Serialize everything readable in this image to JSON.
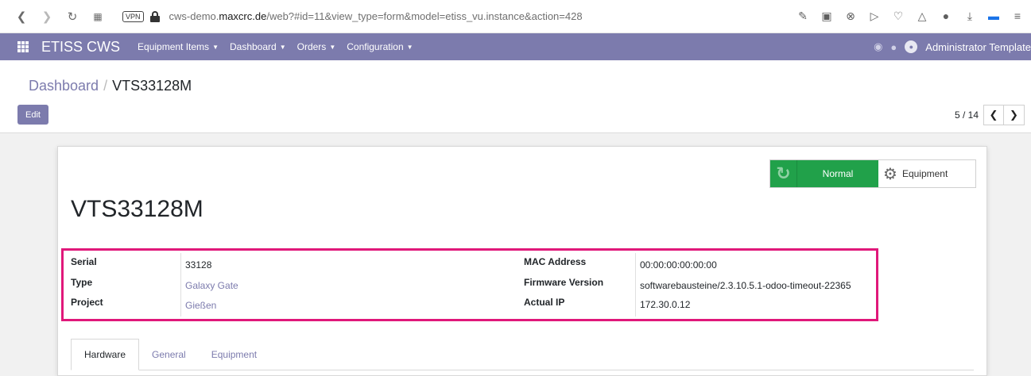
{
  "browser": {
    "url_prefix": "cws-demo.",
    "url_host": "maxcrc.de",
    "url_path": "/web?#id=11&view_type=form&model=etiss_vu.instance&action=428",
    "vpn_label": "VPN"
  },
  "navbar": {
    "brand": "ETISS CWS",
    "menu": [
      {
        "label": "Equipment Items"
      },
      {
        "label": "Dashboard"
      },
      {
        "label": "Orders"
      },
      {
        "label": "Configuration"
      }
    ],
    "user": "Administrator Template",
    "accent_color": "#7c7bad"
  },
  "breadcrumb": {
    "parent": "Dashboard",
    "current": "VTS33128M"
  },
  "control": {
    "edit_label": "Edit",
    "pager": "5 / 14"
  },
  "record": {
    "title": "VTS33128M",
    "state_label": "Normal",
    "equipment_button": "Equipment",
    "fields_left": [
      {
        "label": "Serial",
        "value": "33128"
      },
      {
        "label": "Type",
        "value": "Galaxy Gate"
      },
      {
        "label": "Project",
        "value": "Gießen"
      }
    ],
    "fields_right": [
      {
        "label": "MAC Address",
        "value": "00:00:00:00:00:00"
      },
      {
        "label": "Firmware Version",
        "value": "softwarebausteine/2.3.10.5.1-odoo-timeout-22365"
      },
      {
        "label": "Actual IP",
        "value": "172.30.0.12"
      }
    ]
  },
  "tabs": [
    {
      "label": "Hardware"
    },
    {
      "label": "General"
    },
    {
      "label": "Equipment"
    }
  ]
}
